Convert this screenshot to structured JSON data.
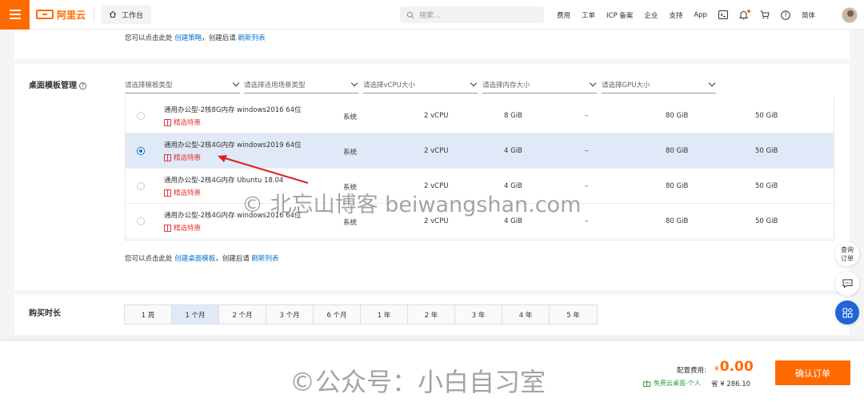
{
  "topbar": {
    "logo_text": "阿里云",
    "workbench_label": "工作台",
    "search_placeholder": "搜索...",
    "nav_items": [
      "费用",
      "工单",
      "ICP 备案",
      "企业",
      "支持",
      "App"
    ],
    "lang_label": "简体"
  },
  "policy_hint": {
    "prefix": "您可以点击此处",
    "link1": "创建策略",
    "middle": "，创建后请",
    "link2": "刷新列表"
  },
  "template_section": {
    "label": "桌面模板管理",
    "filters": [
      "请选择模板类型",
      "请选择适用场景类型",
      "请选择vCPU大小",
      "请选择内存大小",
      "请选择GPU大小"
    ],
    "rows": [
      {
        "name": "通用办公型-2核8G内存 windows2016 64位",
        "tag": "精选特惠",
        "source": "系统",
        "vcpu": "2 vCPU",
        "mem": "8 GiB",
        "gpu": "–",
        "sys_disk": "80 GiB",
        "data_disk": "50 GiB",
        "selected": false
      },
      {
        "name": "通用办公型-2核4G内存 windows2019 64位",
        "tag": "精选特惠",
        "source": "系统",
        "vcpu": "2 vCPU",
        "mem": "4 GiB",
        "gpu": "–",
        "sys_disk": "80 GiB",
        "data_disk": "50 GiB",
        "selected": true
      },
      {
        "name": "通用办公型-2核4G内存 Ubuntu 18.04",
        "tag": "精选特惠",
        "source": "系统",
        "vcpu": "2 vCPU",
        "mem": "4 GiB",
        "gpu": "–",
        "sys_disk": "80 GiB",
        "data_disk": "50 GiB",
        "selected": false
      },
      {
        "name": "通用办公型-2核4G内存 windows2016 64位",
        "tag": "精选特惠",
        "source": "系统",
        "vcpu": "2 vCPU",
        "mem": "4 GiB",
        "gpu": "–",
        "sys_disk": "80 GiB",
        "data_disk": "50 GiB",
        "selected": false
      }
    ],
    "hint": {
      "prefix": "您可以点击此处",
      "link1": "创建桌面模板",
      "middle": "，创建后请",
      "link2": "刷新列表"
    }
  },
  "duration_section": {
    "label": "购买时长",
    "options": [
      "1 周",
      "1 个月",
      "2 个月",
      "3 个月",
      "6 个月",
      "1 年",
      "2 年",
      "3 年",
      "4 年",
      "5 年"
    ],
    "selected": "1 个月"
  },
  "footer": {
    "fee_label": "配置费用:",
    "fee_currency": "¥",
    "fee_value": "0.00",
    "promo_text": "免费云桌面-个人",
    "save_text": "省 ¥ 286.10",
    "confirm_label": "确认订单"
  },
  "float_buttons": {
    "consult_line1": "查询",
    "consult_line2": "订单"
  },
  "watermarks": {
    "center": "© 北忘山博客 beiwangshan.com",
    "bottom": "©公众号：小白自习室"
  },
  "colors": {
    "brand": "#ff6a00",
    "link": "#0070cc",
    "selected_row": "#dfe9f7",
    "tag_red": "#e4393c",
    "promo_green": "#2f9b3e"
  }
}
